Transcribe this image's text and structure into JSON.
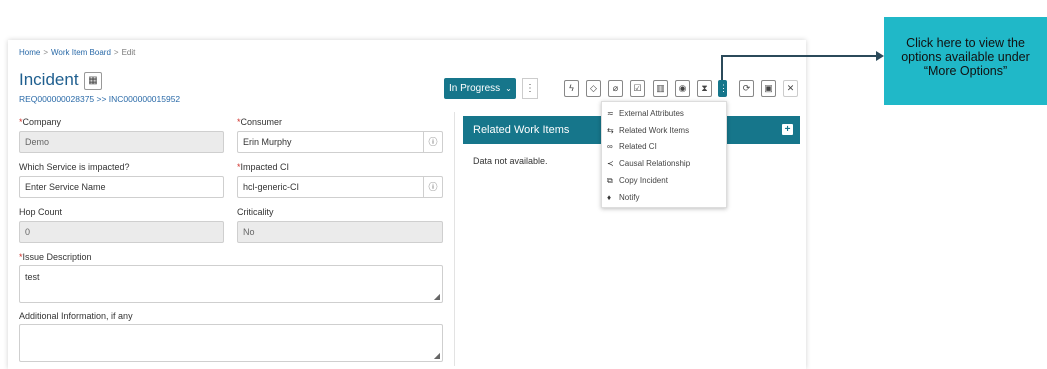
{
  "breadcrumb": {
    "home": "Home",
    "board": "Work Item Board",
    "current": "Edit",
    "sep": ">"
  },
  "header": {
    "title": "Incident",
    "ids": "REQ000000028375 >> INC000000015952",
    "calendar_icon": "calendar-icon"
  },
  "status": {
    "value": "In Progress",
    "chevron": "chevron-down-icon"
  },
  "toolbar": {
    "icons": [
      "bolt-icon",
      "tag-icon",
      "attachment-icon",
      "clipboard-check-icon",
      "book-icon",
      "watch-icon",
      "hourglass-icon",
      "more-options-icon",
      "refresh-icon",
      "save-icon",
      "close-icon"
    ],
    "glyphs": {
      "bolt": "ϟ",
      "tag": "◇",
      "attach": "⌀",
      "clip": "☑",
      "book": "▥",
      "watch": "◉",
      "hour": "⧗",
      "more": "⋮",
      "refresh": "⟳",
      "save": "▣",
      "close": "✕",
      "kebab": "⋮"
    }
  },
  "form": {
    "company": {
      "label": "Company",
      "value": "Demo",
      "required": "*"
    },
    "consumer": {
      "label": "Consumer",
      "value": "Erin Murphy",
      "required": "*"
    },
    "service": {
      "label": "Which Service is impacted?",
      "placeholder": "Enter Service Name"
    },
    "impacted_ci": {
      "label": "Impacted CI",
      "value": "hcl-generic-CI",
      "required": "*"
    },
    "hop_count": {
      "label": "Hop Count",
      "value": "0"
    },
    "criticality": {
      "label": "Criticality",
      "value": "No"
    },
    "issue_description": {
      "label": "Issue Description",
      "value": "test",
      "required": "*"
    },
    "additional_info": {
      "label": "Additional Information, if any",
      "value": ""
    },
    "info_glyph": "ⓘ",
    "grip_glyph": "◢"
  },
  "related": {
    "title": "Related Work Items",
    "empty": "Data not available.",
    "add": "+"
  },
  "more_menu": {
    "items": [
      {
        "label": "External Attributes",
        "icon": "list-icon",
        "glyph": "≂"
      },
      {
        "label": "Related Work Items",
        "icon": "related-items-icon",
        "glyph": "⇆"
      },
      {
        "label": "Related CI",
        "icon": "link-icon",
        "glyph": "∞"
      },
      {
        "label": "Causal Relationship",
        "icon": "share-icon",
        "glyph": "≺"
      },
      {
        "label": "Copy Incident",
        "icon": "copy-icon",
        "glyph": "⧉"
      },
      {
        "label": "Notify",
        "icon": "notify-icon",
        "glyph": "♦"
      }
    ]
  },
  "callout": {
    "text": "Click here to view the options available under “More Options”"
  },
  "colors": {
    "accent": "#16768b",
    "callout": "#20b8c8",
    "link": "#2a6aa8",
    "required": "#d0302a"
  }
}
